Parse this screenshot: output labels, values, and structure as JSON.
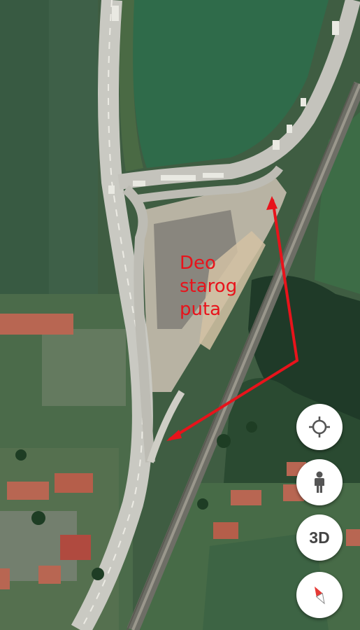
{
  "annotation": {
    "lines": [
      "Deo",
      "starog",
      "puta"
    ],
    "color": "#e8131b"
  },
  "controls": {
    "my_location": {
      "icon": "crosshair-location-icon"
    },
    "street_view": {
      "icon": "pegman-icon"
    },
    "view_3d": {
      "label": "3D"
    },
    "compass": {
      "icon": "compass-icon"
    }
  },
  "colors": {
    "field_green": "#2f6b4a",
    "road": "#c9c9c2",
    "arrow": "#e8131b"
  }
}
